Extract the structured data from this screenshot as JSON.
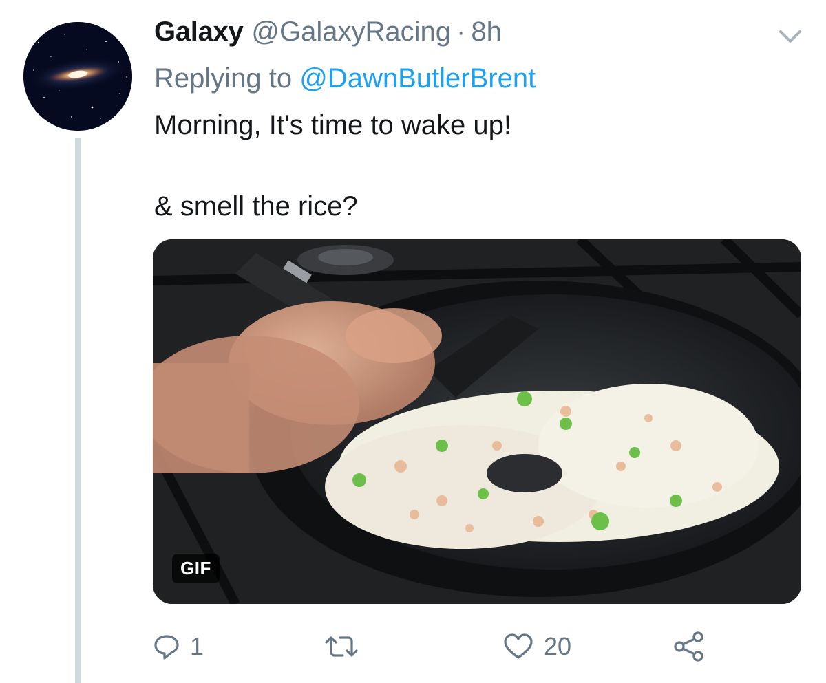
{
  "tweet": {
    "display_name": "Galaxy",
    "handle": "@GalaxyRacing",
    "separator": "·",
    "time": "8h",
    "replying_to_prefix": "Replying to",
    "replying_to_handle": "@DawnButlerBrent",
    "text_line1": "Morning, It's time to wake up!",
    "text_line2": "& smell the rice?",
    "media_badge": "GIF"
  },
  "actions": {
    "reply_count": "1",
    "retweet_count": "",
    "like_count": "20"
  },
  "icons": {
    "menu": "chevron-down-icon",
    "reply": "reply-icon",
    "retweet": "retweet-icon",
    "like": "heart-icon",
    "share": "share-icon"
  },
  "colors": {
    "text_primary": "#14171a",
    "text_secondary": "#657786",
    "link": "#1da1f2",
    "thread_line": "#cfd9de"
  }
}
